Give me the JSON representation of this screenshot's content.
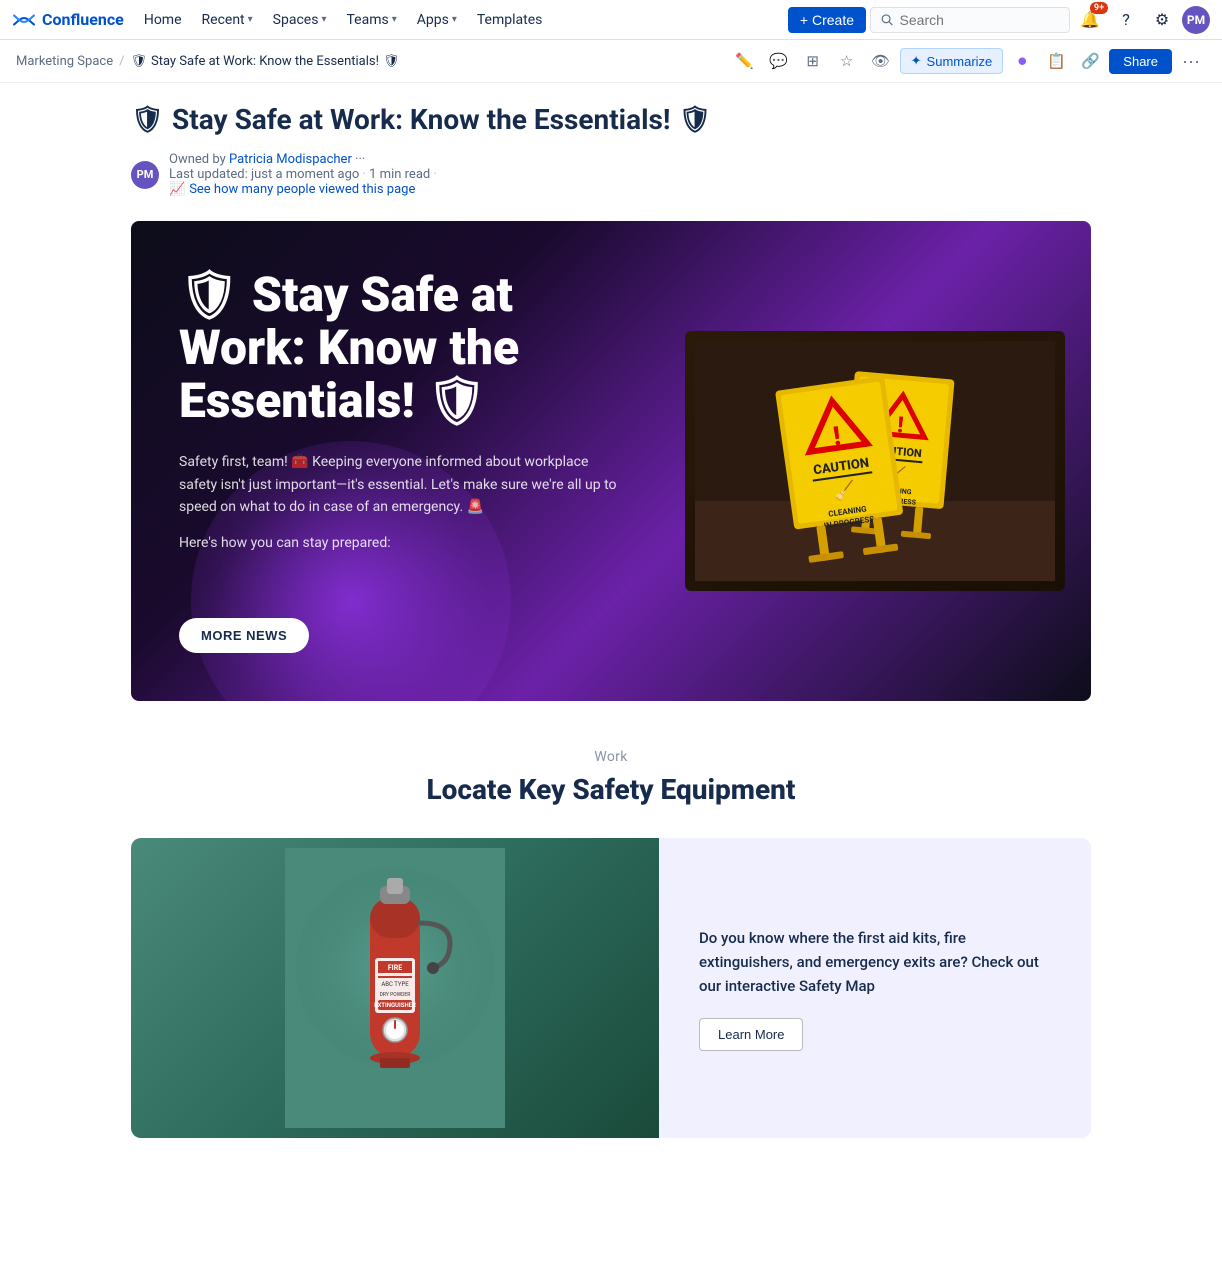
{
  "navbar": {
    "logo_text": "Confluence",
    "nav_items": [
      {
        "label": "Home",
        "has_dropdown": false
      },
      {
        "label": "Recent",
        "has_dropdown": true
      },
      {
        "label": "Spaces",
        "has_dropdown": true
      },
      {
        "label": "Teams",
        "has_dropdown": true
      },
      {
        "label": "Apps",
        "has_dropdown": true
      },
      {
        "label": "Templates",
        "has_dropdown": false
      }
    ],
    "create_label": "+ Create",
    "search_placeholder": "Search",
    "notification_badge": "9+",
    "help_icon": "?",
    "settings_icon": "⚙"
  },
  "breadcrumb": {
    "parent": "Marketing Space",
    "current": "Stay Safe at Work: Know the Essentials!",
    "icon": "🛡"
  },
  "toolbar": {
    "edit_title": "Edit",
    "comment_title": "Comment",
    "layout_title": "Layout",
    "star_title": "Star",
    "watch_title": "Watch",
    "summarize_label": "Summarize",
    "more_label": "...",
    "share_label": "Share"
  },
  "page": {
    "title": "Stay Safe at Work: Know the Essentials!",
    "title_icon_left": "🛡",
    "title_icon_right": "🛡",
    "author_name": "Patricia Modispacher",
    "author_initials": "PM",
    "owned_by": "Owned by",
    "last_updated": "Last updated: just a moment ago",
    "read_time": "1 min read",
    "views_text": "See how many people viewed this page"
  },
  "hero": {
    "title_icon": "🛡",
    "title": "Stay Safe at Work: Know the Essentials!",
    "title_icon2": "🛡",
    "description": "Safety first, team! 🧰 Keeping everyone informed about workplace safety isn't just important—it's essential. Let's make sure we're all up to speed on what to do in case of an emergency. 🚨",
    "subtitle": "Here's how you can stay prepared:",
    "button_label": "MORE NEWS"
  },
  "safety_section": {
    "section_label": "Work",
    "section_title": "Locate Key Safety Equipment",
    "description": "Do you know where the first aid kits, fire extinguishers, and emergency exits are? Check out our interactive Safety Map",
    "button_label": "Learn More"
  }
}
